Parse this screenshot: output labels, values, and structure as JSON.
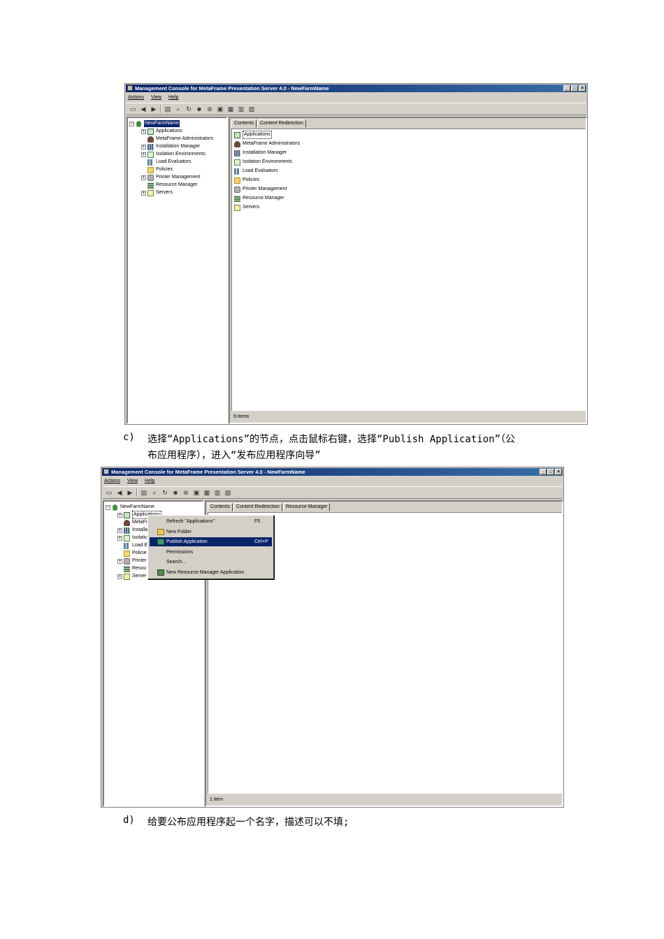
{
  "window_title": "Management Console for MetaFrame Presentation Server 4.0 - NewFarmName",
  "menu": [
    "Actions",
    "View",
    "Help"
  ],
  "tree": {
    "root": "NewFarmName",
    "children": [
      {
        "label": "Applications",
        "icon": "application-icon",
        "expandable": true
      },
      {
        "label": "MetaFrame Administrators",
        "icon": "administrator-icon",
        "expandable": false
      },
      {
        "label": "Installation Manager",
        "icon": "installation-icon",
        "expandable": true
      },
      {
        "label": "Isolation Environments",
        "icon": "isolation-icon",
        "expandable": true
      },
      {
        "label": "Load Evaluators",
        "icon": "load-evaluator-icon",
        "expandable": false
      },
      {
        "label": "Policies",
        "icon": "policy-icon",
        "expandable": false
      },
      {
        "label": "Printer Management",
        "icon": "printer-icon",
        "expandable": true
      },
      {
        "label": "Resource Manager",
        "icon": "resource-icon",
        "expandable": false
      },
      {
        "label": "Servers",
        "icon": "server-icon",
        "expandable": true
      }
    ]
  },
  "screen1": {
    "tabs": [
      "Contents",
      "Content Redirection"
    ],
    "list_items": [
      "Applications",
      "MetaFrame Administrators",
      "Installation Manager",
      "Isolation Environments",
      "Load Evaluators",
      "Policies",
      "Printer Management",
      "Resource Manager",
      "Servers"
    ],
    "status": "9 items"
  },
  "caption_c": {
    "marker": "c)",
    "line1": "选择“Applications”的节点，点击鼠标右键，选择“Publish Application”（公",
    "line2": "布应用程序），进入“发布应用程序向导”"
  },
  "screen2": {
    "tabs": [
      "Contents",
      "Content Redirection",
      "Resource Manager"
    ],
    "tree_truncated": [
      "Applications",
      "MetaFr",
      "Installa",
      "Isolatic",
      "Load E",
      "Policie",
      "Printer",
      "Resou",
      "Server"
    ],
    "context_menu": [
      {
        "label": "Refresh \"Applications\"",
        "shortcut": "F5"
      },
      {
        "label": "New Folder",
        "shortcut": ""
      },
      {
        "label": "Publish Application",
        "shortcut": "Ctrl+P",
        "highlighted": true
      },
      {
        "label": "Permissions",
        "shortcut": ""
      },
      {
        "label": "Search...",
        "shortcut": ""
      },
      {
        "label": "New Resource Manager Application",
        "shortcut": ""
      }
    ],
    "status": "1 item"
  },
  "caption_d": {
    "marker": "d)",
    "line1": "给要公布应用程序起一个名字，描述可以不填;"
  }
}
